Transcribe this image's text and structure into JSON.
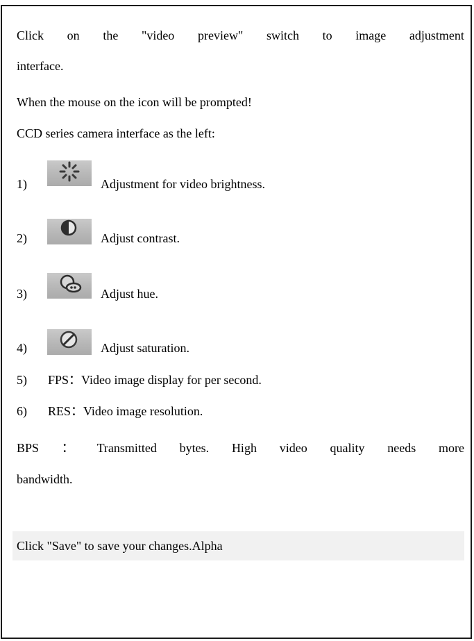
{
  "intro": {
    "line1_words": [
      "Click",
      "on",
      "the",
      "\"video",
      "preview\"",
      "switch",
      "to",
      "image",
      "adjustment"
    ],
    "line1_cont": "interface.",
    "mouse_hint": "When the mouse on the icon will be prompted!",
    "ccd_line": "CCD series camera interface as the left:"
  },
  "items": [
    {
      "num": "1)",
      "icon": "brightness-icon",
      "text": "Adjustment for video brightness."
    },
    {
      "num": "2)",
      "icon": "contrast-icon",
      "text": "Adjust contrast."
    },
    {
      "num": "3)",
      "icon": "hue-icon",
      "text": "Adjust hue."
    },
    {
      "num": "4)",
      "icon": "saturation-icon",
      "text": "Adjust saturation."
    },
    {
      "num": "5)",
      "text": "FPS：Video image display for per second."
    },
    {
      "num": "6)",
      "text": "RES：Video image resolution."
    }
  ],
  "bps": {
    "words": [
      "BPS",
      "：",
      "Transmitted",
      "bytes.",
      "High",
      "video",
      "quality",
      "needs",
      "more"
    ],
    "cont": "bandwidth."
  },
  "save_note": "Click \"Save\" to save your changes.Alpha"
}
